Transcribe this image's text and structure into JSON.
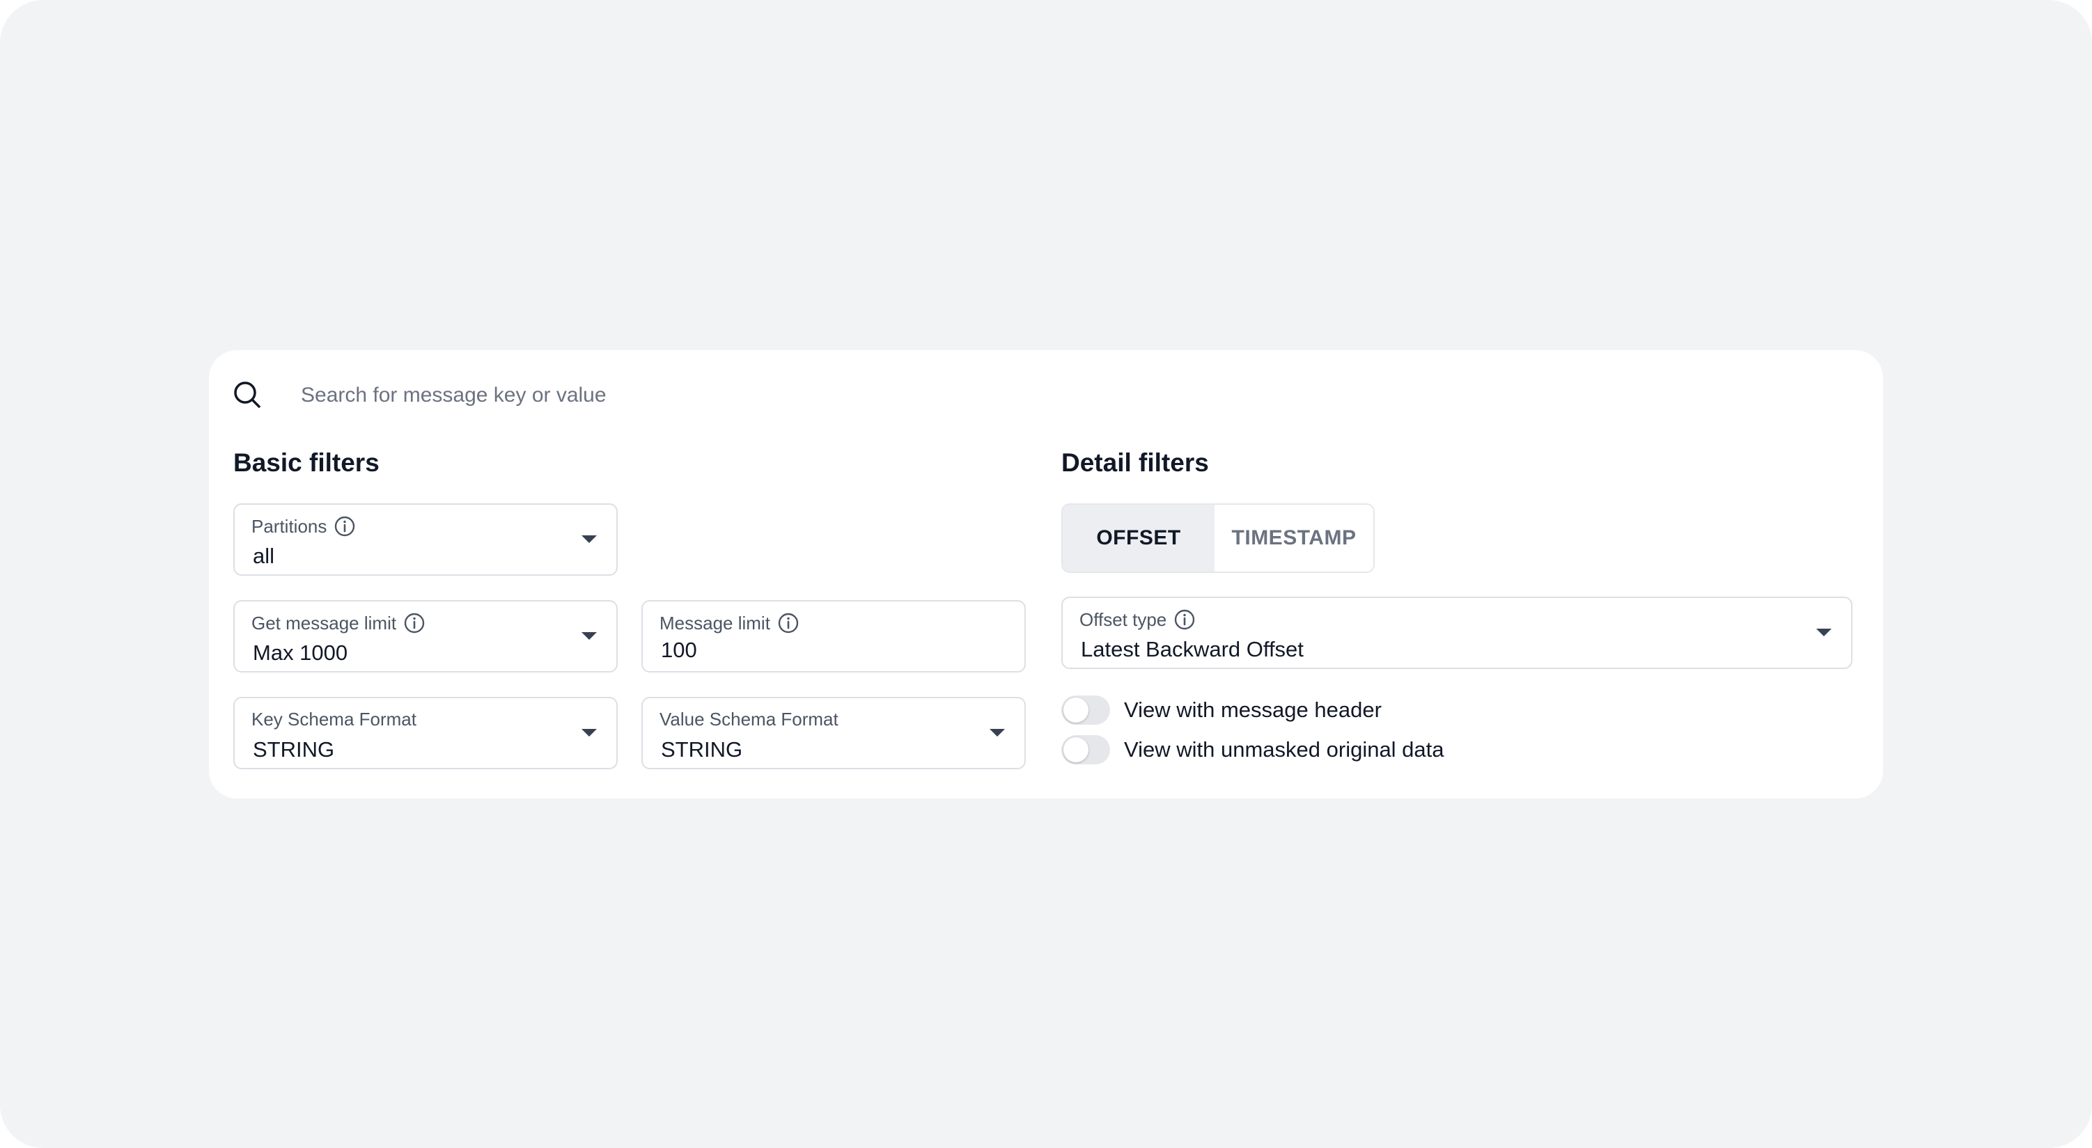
{
  "search": {
    "placeholder": "Search for message key or value"
  },
  "basic_filters": {
    "title": "Basic filters",
    "partitions": {
      "label": "Partitions",
      "value": "all"
    },
    "get_message_limit": {
      "label": "Get message limit",
      "value": "Max 1000"
    },
    "message_limit": {
      "label": "Message limit",
      "value": "100"
    },
    "key_schema_format": {
      "label": "Key Schema Format",
      "value": "STRING"
    },
    "value_schema_format": {
      "label": "Value Schema Format",
      "value": "STRING"
    }
  },
  "detail_filters": {
    "title": "Detail filters",
    "tabs": [
      {
        "label": "OFFSET",
        "active": true
      },
      {
        "label": "TIMESTAMP",
        "active": false
      }
    ],
    "offset_type": {
      "label": "Offset type",
      "value": "Latest Backward Offset"
    },
    "toggles": [
      {
        "label": "View with message header",
        "on": false
      },
      {
        "label": "View with unmasked original data",
        "on": false
      }
    ]
  },
  "icons": {
    "search": "search-icon",
    "info": "info-icon",
    "dropdown": "chevron-down-icon"
  },
  "colors": {
    "background": "#f2f3f5",
    "panel": "#ffffff",
    "text": "#111827",
    "muted": "#6b7280",
    "border": "#dcdfe4",
    "active_tab": "#eceef1",
    "toggle_off": "#e5e7eb"
  }
}
